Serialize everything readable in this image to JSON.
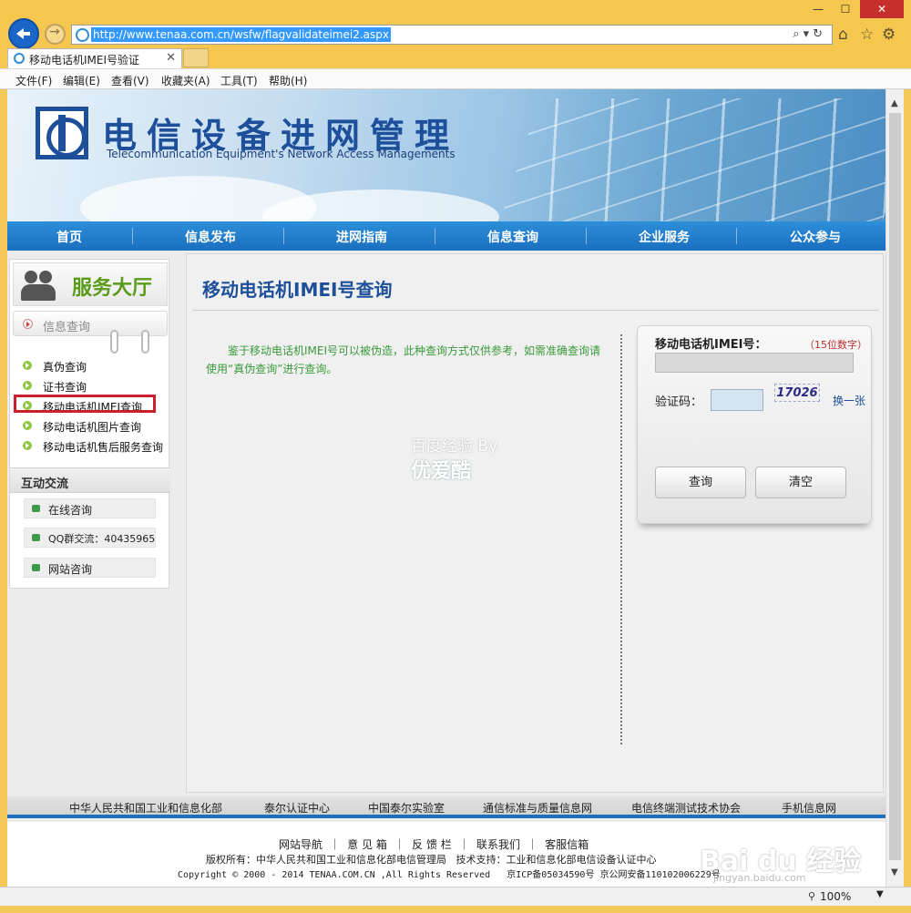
{
  "browser": {
    "url": "http://www.tenaa.com.cn/wsfw/flagvalidateimei2.aspx",
    "tab_title": "移动电话机IMEI号验证",
    "menu": [
      "文件(F)",
      "编辑(E)",
      "查看(V)",
      "收藏夹(A)",
      "工具(T)",
      "帮助(H)"
    ],
    "zoom": "100%"
  },
  "header": {
    "title": "电信设备进网管理",
    "subtitle": "Telecommunication Equipment's Network Access Managements"
  },
  "nav": [
    "首页",
    "信息发布",
    "进网指南",
    "信息查询",
    "企业服务",
    "公众参与"
  ],
  "sidebar": {
    "service_title": "服务大厅",
    "section": "信息查询",
    "links": [
      "真伪查询",
      "证书查询",
      "移动电话机IMEI查询",
      "移动电话机图片查询",
      "移动电话机售后服务查询"
    ],
    "interact_title": "互动交流",
    "interact": [
      "在线咨询",
      "QQ群交流：40435965",
      "网站咨询"
    ]
  },
  "main": {
    "title": "移动电话机IMEI号查询",
    "notice": "鉴于移动电话机IMEI号可以被伪造，此种查询方式仅供参考，如需准确查询请使用“真伪查询”进行查询。",
    "watermark1": "百度经验 By",
    "watermark2": "优爱酷",
    "form": {
      "imei_label": "移动电话机IMEI号：",
      "imei_hint": "（15位数字）",
      "captcha_label": "验证码：",
      "captcha_image": "17026",
      "refresh": "换一张",
      "query_btn": "查询",
      "clear_btn": "清空"
    }
  },
  "footer": {
    "links": [
      "中华人民共和国工业和信息化部",
      "泰尔认证中心",
      "中国泰尔实验室",
      "通信标准与质量信息网",
      "电信终端测试技术协会",
      "手机信息网"
    ],
    "row1": "网站导航  ｜  意 见 箱  ｜  反 馈 栏  ｜  联系我们  ｜  客服信箱",
    "row2": "版权所有：中华人民共和国工业和信息化部电信管理局   技术支持：工业和信息化部电信设备认证中心",
    "row3": "Copyright © 2000 - 2014 TENAA.COM.CN ,All Rights Reserved   京ICP备05034590号 京公网安备110102006229号",
    "baidu": "Bai du 经验",
    "baidu_url": "jingyan.baidu.com"
  }
}
